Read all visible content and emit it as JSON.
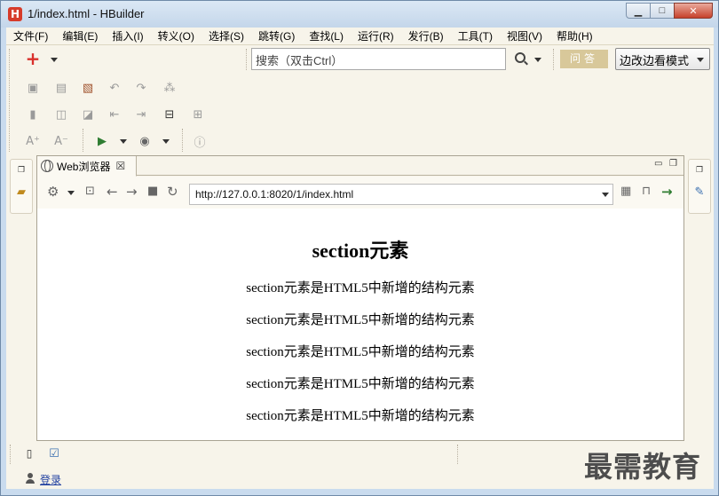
{
  "window": {
    "title": "1/index.html  -  HBuilder",
    "logo_letter": "H",
    "minimize_glyph": "▁",
    "maximize_glyph": "□",
    "close_glyph": "✕"
  },
  "menu": [
    "文件(F)",
    "编辑(E)",
    "插入(I)",
    "转义(O)",
    "选择(S)",
    "跳转(G)",
    "查找(L)",
    "运行(R)",
    "发行(B)",
    "工具(T)",
    "视图(V)",
    "帮助(H)"
  ],
  "toolbar": {
    "search_placeholder": "搜索（双击Ctrl）",
    "qa_label": "问答",
    "mode_label": "边改边看模式"
  },
  "editor_tab": {
    "label": "Web浏览器",
    "close_glyph": "☒"
  },
  "browser": {
    "url": "http://127.0.0.1:8020/1/index.html"
  },
  "page": {
    "heading": "section元素",
    "paragraphs": [
      "section元素是HTML5中新增的结构元素",
      "section元素是HTML5中新增的结构元素",
      "section元素是HTML5中新增的结构元素",
      "section元素是HTML5中新增的结构元素",
      "section元素是HTML5中新增的结构元素"
    ]
  },
  "status": {
    "login_label": "登录"
  },
  "watermark": "最需教育",
  "colors": {
    "chrome": "#c9dbee",
    "panel": "#f7f4ea",
    "qa_button": "#d8c89a",
    "add_icon": "#d9302c",
    "link": "#1f3fa0"
  }
}
